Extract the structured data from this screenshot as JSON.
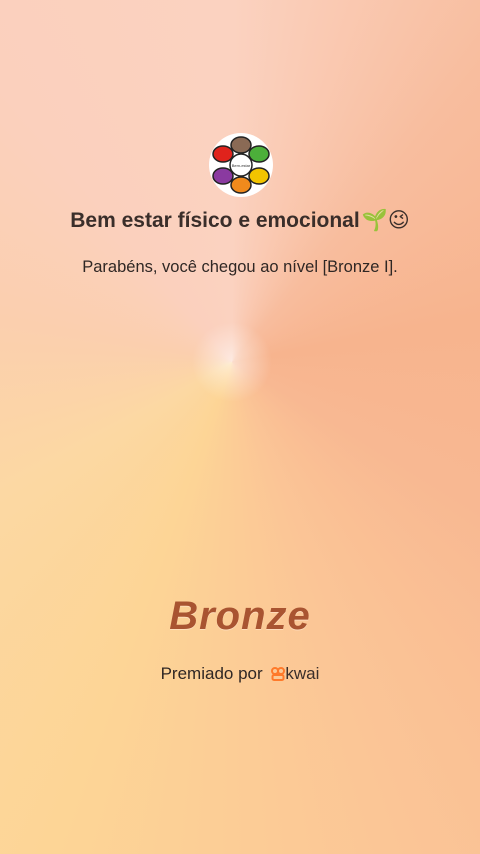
{
  "header": {
    "logo_label": "Bem-estar",
    "title": "Bem estar físico e emocional",
    "title_emojis": "🌱😉",
    "message": "Parabéns, você chegou ao nível [Bronze I]."
  },
  "badge": {
    "level_name": "Bronze"
  },
  "footer": {
    "awarded_by": "Premiado por",
    "brand": "kwai"
  },
  "colors": {
    "level_text": "#a95431",
    "brand_icon": "#ff7a2a"
  }
}
